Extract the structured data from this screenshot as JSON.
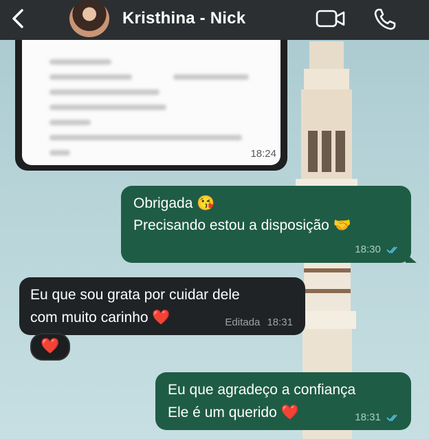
{
  "header": {
    "contact_name": "Kristhina - Nick",
    "back_icon": "chevron-left-icon",
    "video_icon": "video-camera-icon",
    "call_icon": "phone-icon"
  },
  "messages": {
    "image_time": "18:24",
    "msg1": {
      "line1": "Obrigada",
      "line1_emoji": "😘",
      "line2": "Precisando estou a disposição",
      "line2_emoji": "🤝",
      "time": "18:30"
    },
    "msg2": {
      "line1": "Eu que sou grata por  cuidar dele",
      "line2": "com muito carinho",
      "line2_emoji": "❤️",
      "edited": "Editada",
      "time": "18:31",
      "reaction": "❤️"
    },
    "msg3": {
      "line1": "Eu que agradeço a confiança",
      "line2": "Ele é um querido",
      "line2_emoji": "❤️",
      "time": "18:31"
    }
  },
  "colors": {
    "header_bg": "#2b2f31",
    "outgoing_bubble": "#1f5c45",
    "incoming_bubble": "#202325",
    "read_ticks": "#53bdeb"
  }
}
